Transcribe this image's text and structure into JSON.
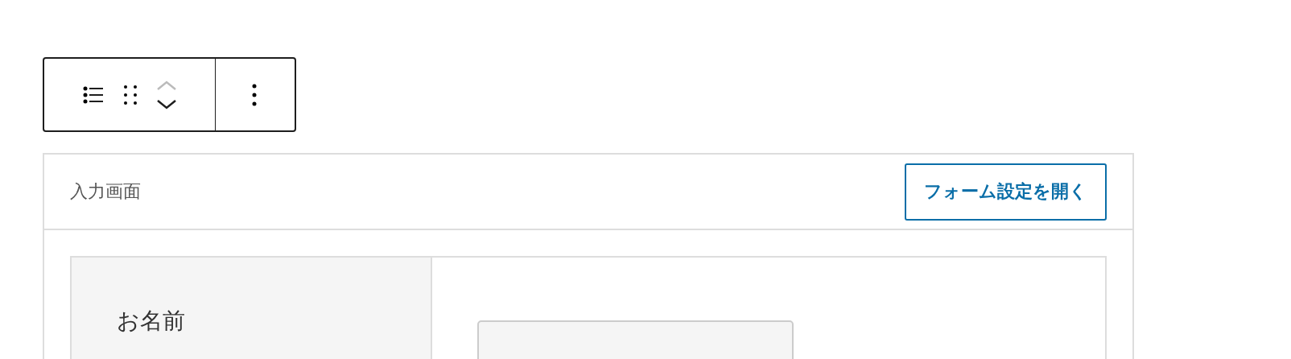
{
  "toolbar": {
    "up_disabled": true,
    "down_disabled": false
  },
  "block": {
    "title": "入力画面",
    "button": "フォーム設定を開く",
    "fields": [
      {
        "label": "お名前"
      }
    ]
  }
}
